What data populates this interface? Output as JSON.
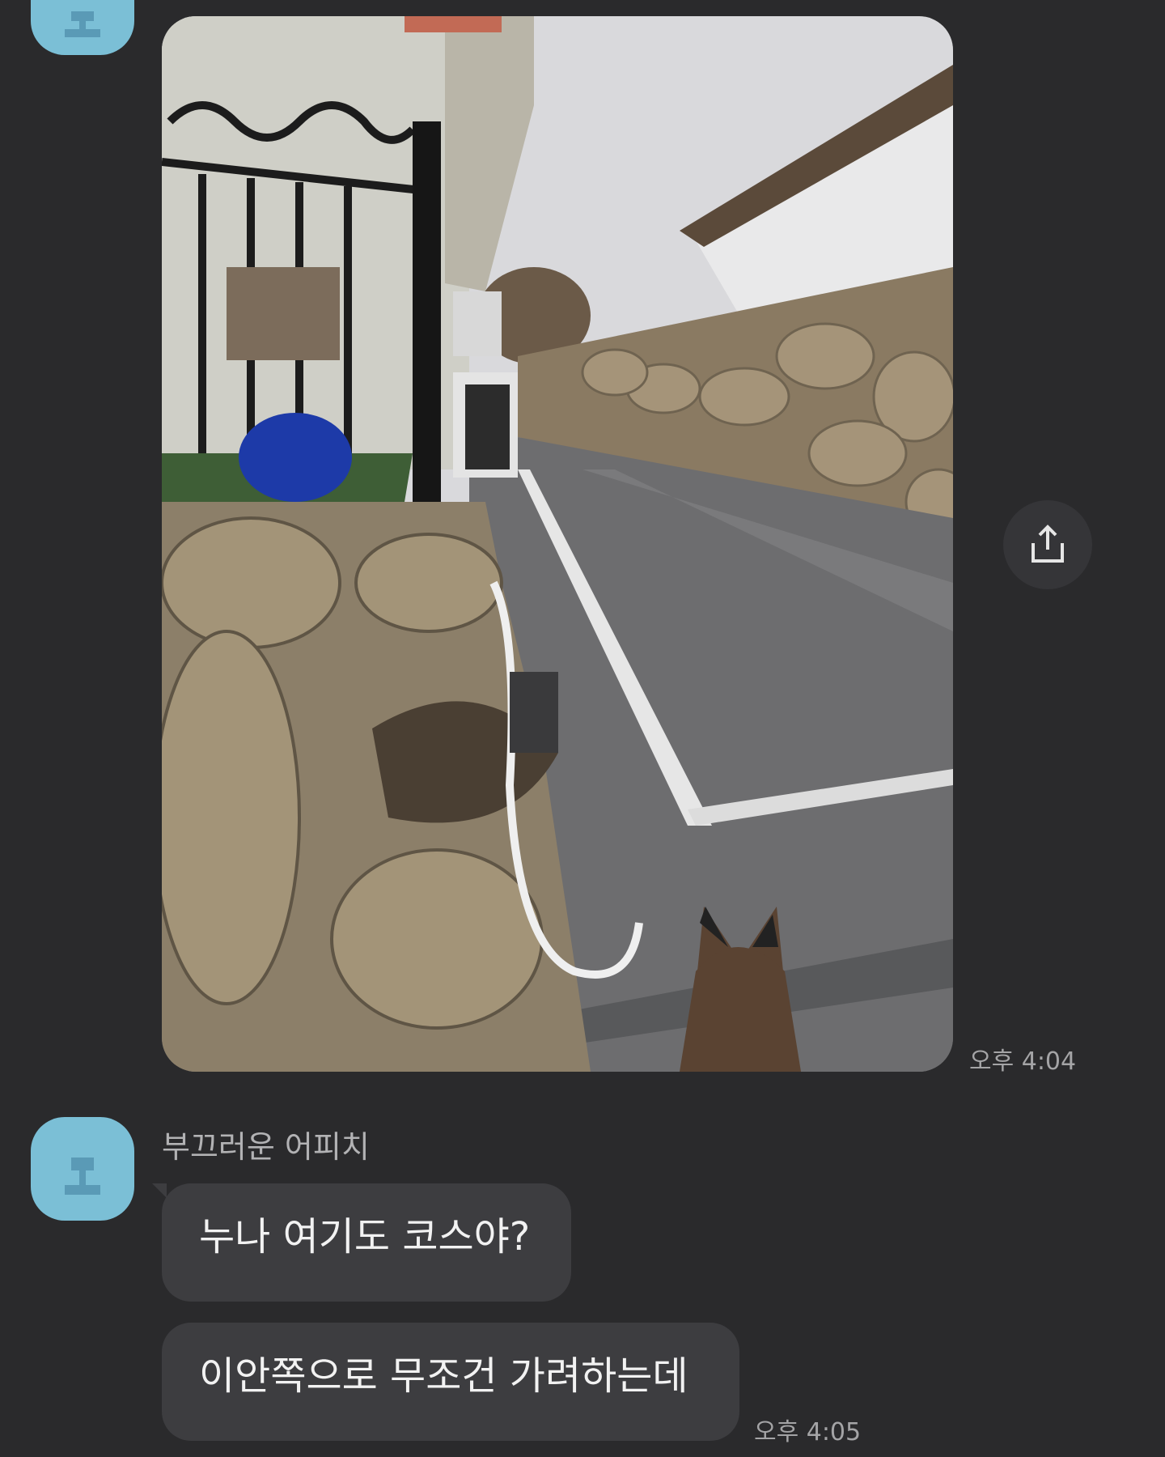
{
  "messages": [
    {
      "type": "image",
      "image_description": "photo",
      "time": "오후 4:04"
    },
    {
      "type": "text",
      "sender": "부끄러운 어피치",
      "text": "누나 여기도 코스야?"
    },
    {
      "type": "text",
      "text": "이안쪽으로 무조건 가려하는데",
      "time": "오후 4:05"
    }
  ],
  "colors": {
    "background": "#2a2a2c",
    "bubble": "#3d3d40",
    "avatar": "#7bbfd6"
  },
  "icons": {
    "share": "share-icon",
    "avatar": "avatar-icon"
  }
}
